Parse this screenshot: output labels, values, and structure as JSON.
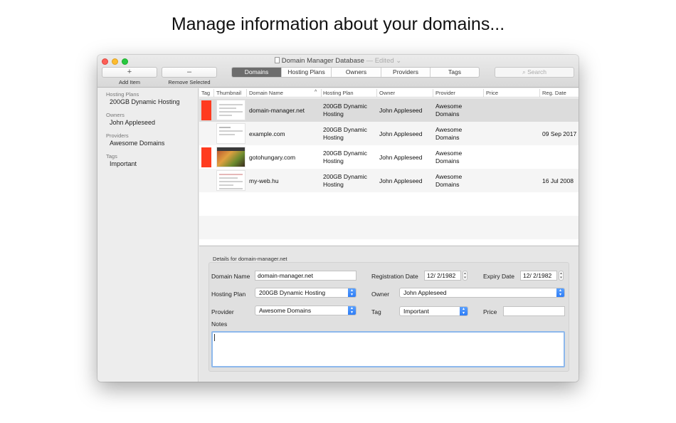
{
  "headline": "Manage information about your domains...",
  "window": {
    "title": "Domain Manager Database",
    "edited": "— Edited"
  },
  "toolbar": {
    "add_symbol": "+",
    "add_label": "Add Item",
    "remove_symbol": "–",
    "remove_label": "Remove Selected",
    "tabs": [
      "Domains",
      "Hosting Plans",
      "Owners",
      "Providers",
      "Tags"
    ],
    "active_tab": "Domains",
    "search_placeholder": "Search"
  },
  "sidebar": {
    "sections": [
      {
        "heading": "Hosting Plans",
        "item": "200GB Dynamic Hosting"
      },
      {
        "heading": "Owners",
        "item": "John Appleseed"
      },
      {
        "heading": "Providers",
        "item": "Awesome Domains"
      },
      {
        "heading": "Tags",
        "item": "Important"
      }
    ]
  },
  "table": {
    "columns": [
      "Tag",
      "Thumbnail",
      "Domain Name",
      "Hosting Plan",
      "Owner",
      "Provider",
      "Price",
      "Reg. Date"
    ],
    "rows": [
      {
        "tag": "red",
        "domain": "domain-manager.net",
        "plan_line1": "200GB Dynamic",
        "plan_line2": "Hosting",
        "owner": "John Appleseed",
        "provider_line1": "Awesome",
        "provider_line2": "Domains",
        "price": "",
        "reg_date": ""
      },
      {
        "tag": "",
        "domain": "example.com",
        "plan_line1": "200GB Dynamic",
        "plan_line2": "Hosting",
        "owner": "John Appleseed",
        "provider_line1": "Awesome",
        "provider_line2": "Domains",
        "price": "",
        "reg_date": "09 Sep 2017"
      },
      {
        "tag": "red",
        "domain": "gotohungary.com",
        "plan_line1": "200GB Dynamic",
        "plan_line2": "Hosting",
        "owner": "John Appleseed",
        "provider_line1": "Awesome",
        "provider_line2": "Domains",
        "price": "",
        "reg_date": ""
      },
      {
        "tag": "",
        "domain": "my-web.hu",
        "plan_line1": "200GB Dynamic",
        "plan_line2": "Hosting",
        "owner": "John Appleseed",
        "provider_line1": "Awesome",
        "provider_line2": "Domains",
        "price": "",
        "reg_date": "16 Jul 2008"
      }
    ]
  },
  "details": {
    "title": "Details for domain-manager.net",
    "domain_name_label": "Domain Name",
    "domain_name_value": "domain-manager.net",
    "registration_label": "Registration Date",
    "registration_value": "12/ 2/1982",
    "expiry_label": "Expiry Date",
    "expiry_value": "12/ 2/1982",
    "hosting_label": "Hosting Plan",
    "hosting_value": "200GB Dynamic Hosting",
    "owner_label": "Owner",
    "owner_value": "John Appleseed",
    "provider_label": "Provider",
    "provider_value": "Awesome Domains",
    "tag_label": "Tag",
    "tag_value": "Important",
    "price_label": "Price",
    "price_value": "",
    "notes_label": "Notes",
    "notes_value": ""
  },
  "colors": {
    "tag_red": "#ff3b1f",
    "accent_blue": "#2e7cf6",
    "selected_row": "#dcdcdc"
  }
}
